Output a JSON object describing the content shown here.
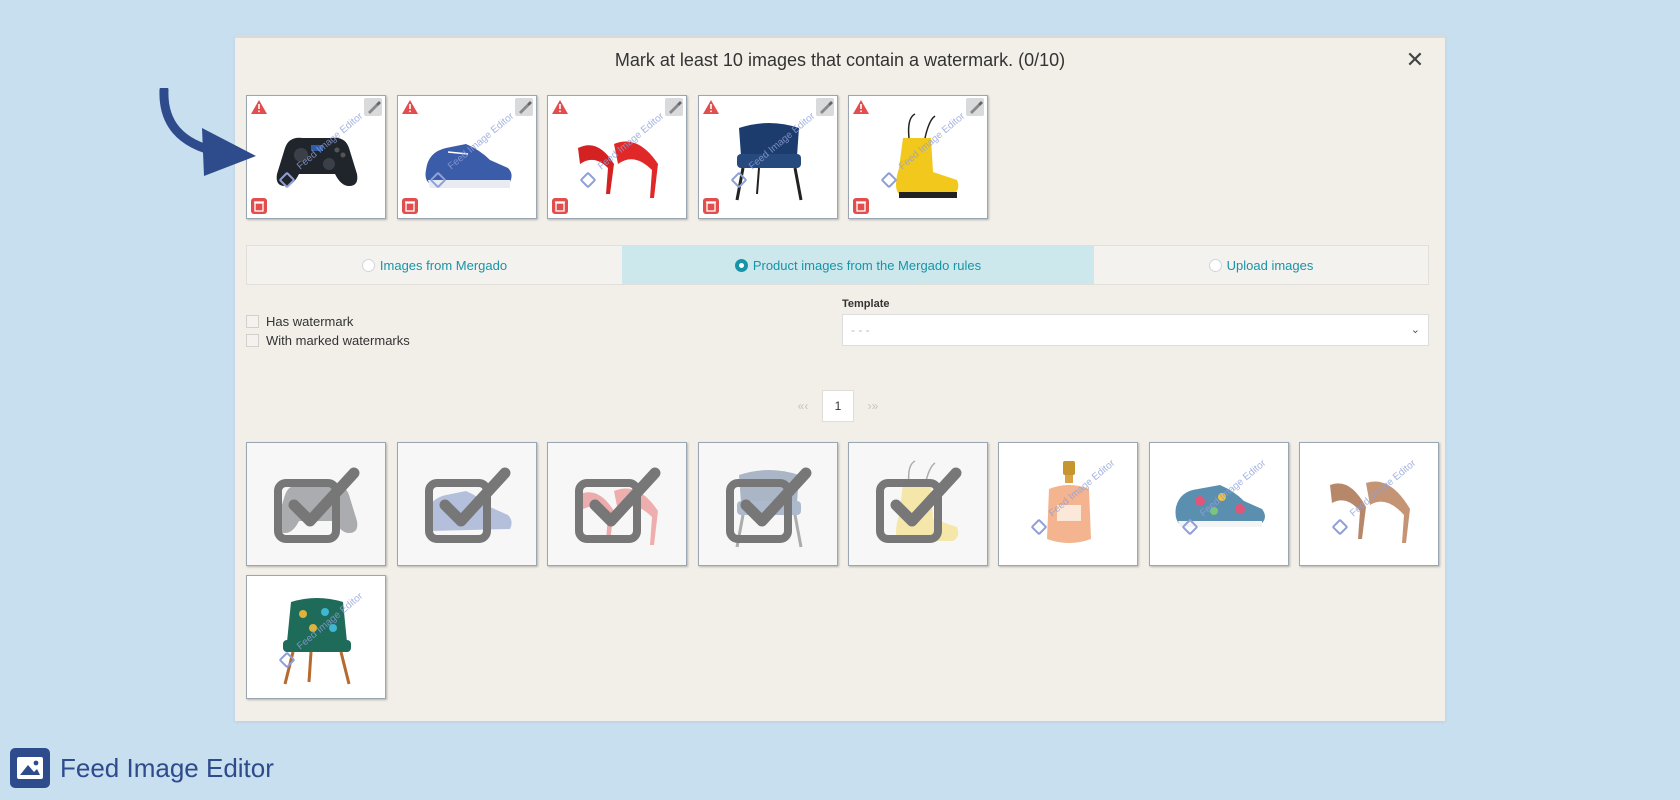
{
  "modal": {
    "title": "Mark at least 10 images that contain a watermark. (0/10)",
    "close_icon": "✕"
  },
  "selected_images": [
    {
      "product": "game controller",
      "watermark": "Feed Image Editor"
    },
    {
      "product": "blue sneaker",
      "watermark": "Feed Image Editor"
    },
    {
      "product": "red high heels",
      "watermark": "Feed Image Editor"
    },
    {
      "product": "blue chair",
      "watermark": "Feed Image Editor"
    },
    {
      "product": "yellow boot",
      "watermark": "Feed Image Editor"
    }
  ],
  "tabs": [
    {
      "label": "Images from Mergado",
      "active": false
    },
    {
      "label": "Product images from the Mergado rules",
      "active": true
    },
    {
      "label": "Upload images",
      "active": false
    }
  ],
  "filters": {
    "has_watermark": "Has watermark",
    "with_marked_watermarks": "With marked watermarks"
  },
  "template": {
    "label": "Template",
    "value": "- - -"
  },
  "pager": {
    "prev": "«‹",
    "page": "1",
    "next": "›»"
  },
  "grid": [
    {
      "product": "game controller",
      "selected": true
    },
    {
      "product": "blue sneaker",
      "selected": true
    },
    {
      "product": "red high heels",
      "selected": true
    },
    {
      "product": "blue chair",
      "selected": true
    },
    {
      "product": "yellow boot",
      "selected": true
    },
    {
      "product": "perfume bottle",
      "selected": false,
      "watermark": "Feed Image Editor"
    },
    {
      "product": "floral sneaker",
      "selected": false,
      "watermark": "Feed Image Editor"
    },
    {
      "product": "beige high heels",
      "selected": false,
      "watermark": "Feed Image Editor"
    },
    {
      "product": "patterned chair",
      "selected": false,
      "watermark": "Feed Image Editor"
    }
  ],
  "brand": {
    "name": "Feed Image Editor"
  },
  "colors": {
    "accent": "#1794a8",
    "brand": "#2e4b8c",
    "warning": "#e24d4d"
  }
}
